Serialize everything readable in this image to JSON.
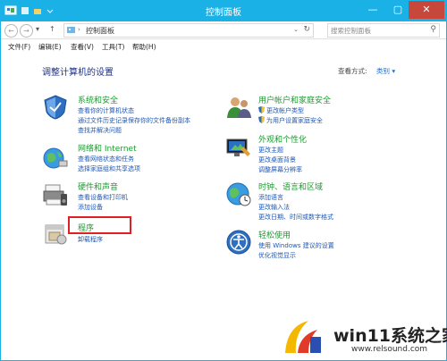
{
  "window": {
    "title": "控制面板",
    "min_glyph": "—",
    "max_glyph": "▢",
    "close_glyph": "✕"
  },
  "address": {
    "crumb": "控制面板",
    "search_placeholder": "搜索控制面板"
  },
  "menu": [
    "文件(F)",
    "编辑(E)",
    "查看(V)",
    "工具(T)",
    "帮助(H)"
  ],
  "content": {
    "heading": "调整计算机的设置",
    "view_by_label": "查看方式:",
    "view_by_value": "类别 ▾"
  },
  "categories": [
    {
      "title": "系统和安全",
      "icon": "shield-icon",
      "links": [
        "查看你的计算机状态",
        "通过文件历史记录保存你的文件备份副本",
        "查找并解决问题"
      ]
    },
    {
      "title": "网络和 Internet",
      "icon": "network-globe-icon",
      "links": [
        "查看网络状态和任务",
        "选择家庭组和共享选项"
      ]
    },
    {
      "title": "硬件和声音",
      "icon": "printer-icon",
      "links": [
        "查看设备和打印机",
        "添加设备"
      ]
    },
    {
      "title": "程序",
      "icon": "programs-icon",
      "links": [
        "卸载程序"
      ]
    },
    {
      "title": "用户帐户和家庭安全",
      "icon": "users-icon",
      "links": [
        "更改帐户类型",
        "为用户设置家庭安全"
      ]
    },
    {
      "title": "外观和个性化",
      "icon": "display-icon",
      "links": [
        "更改主题",
        "更改桌面背景",
        "调整屏幕分辨率"
      ]
    },
    {
      "title": "时钟、语言和区域",
      "icon": "clock-globe-icon",
      "links": [
        "添加语言",
        "更改输入法",
        "更改日期、时间或数字格式"
      ]
    },
    {
      "title": "轻松使用",
      "icon": "accessibility-icon",
      "links": [
        "使用 Windows 建议的设置",
        "优化视觉显示"
      ]
    }
  ],
  "watermark": {
    "text": "win11系统之家",
    "url": "www.relsound.com"
  },
  "colors": {
    "titlebar": "#19b1e6",
    "category_title": "#1e9a32",
    "link": "#1e57b4",
    "highlight_box": "#e02020"
  }
}
